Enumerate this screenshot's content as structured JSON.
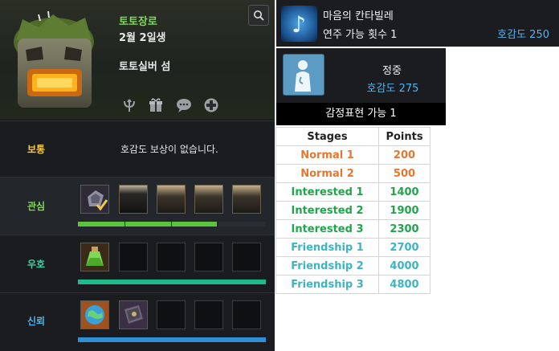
{
  "npc": {
    "name": "토토장로",
    "birthday": "2월 2일생",
    "location": "토토실버 섬"
  },
  "header_icons": [
    "trident-icon",
    "gift-icon",
    "chat-bubble-icon",
    "medal-icon"
  ],
  "stages": {
    "normal": {
      "label": "보통",
      "message": "호감도 보상이 없습니다."
    },
    "interest": {
      "label": "관심",
      "progress": 0.74
    },
    "friendship": {
      "label": "우호",
      "progress": 1.0
    },
    "trust": {
      "label": "신뢰",
      "progress": 1.0
    }
  },
  "colors": {
    "normal_label": "#f2c94c",
    "interest_label": "#7ed957",
    "friend_label": "#3fd4a4",
    "trust_label": "#4fb4f0",
    "interest_bar": "#5ac43c",
    "friend_bar": "#1fba8a",
    "trust_bar": "#2f8fd6",
    "affinity_text": "#4fb4f0"
  },
  "card_music": {
    "title": "마음의 칸타빌레",
    "count_label": "연주 가능 횟수 1",
    "affinity": "호감도 250",
    "icon": "music-note-icon"
  },
  "card_emotion": {
    "name": "정중",
    "affinity": "호감도 275",
    "footer": "감정표현 가능 1",
    "icon": "bow-gesture-icon"
  },
  "points_table": {
    "headers": [
      "Stages",
      "Points"
    ],
    "rows": [
      {
        "stage": "Normal 1",
        "points": "200",
        "color": "#e8772e"
      },
      {
        "stage": "Normal 2",
        "points": "500",
        "color": "#e8772e"
      },
      {
        "stage": "Interested 1",
        "points": "1400",
        "color": "#1fa54a"
      },
      {
        "stage": "Interested 2",
        "points": "1900",
        "color": "#1fa54a"
      },
      {
        "stage": "Interested 3",
        "points": "2300",
        "color": "#1fa54a"
      },
      {
        "stage": "Friendship 1",
        "points": "2700",
        "color": "#3bb4c4"
      },
      {
        "stage": "Friendship 2",
        "points": "4000",
        "color": "#3bb4c4"
      },
      {
        "stage": "Friendship 3",
        "points": "4800",
        "color": "#3bb4c4"
      }
    ]
  }
}
